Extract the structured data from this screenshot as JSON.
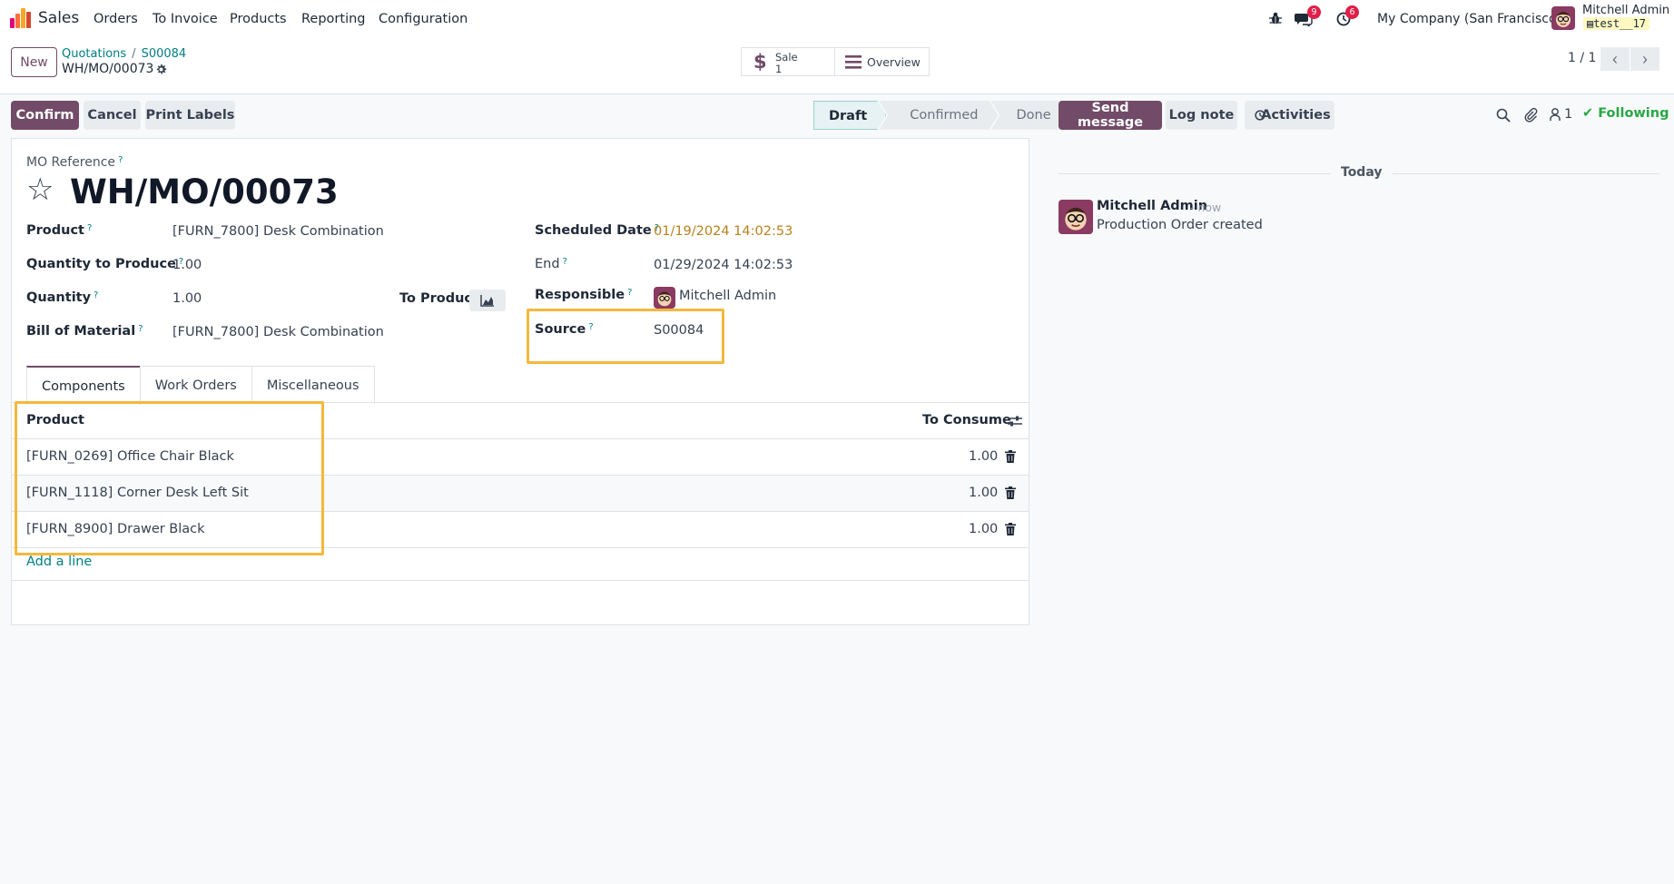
{
  "navbar": {
    "app_name": "Sales",
    "menu": [
      "Orders",
      "To Invoice",
      "Products",
      "Reporting",
      "Configuration"
    ],
    "messages_count": "9",
    "activities_count": "6",
    "company": "My Company (San Francisco)",
    "user_name": "Mitchell Admin",
    "database": "test__17"
  },
  "breadcrumb": {
    "new_label": "New",
    "items": [
      "Quotations",
      "S00084"
    ],
    "current": "WH/MO/00073"
  },
  "smart_buttons": {
    "sale_label": "Sale",
    "sale_count": "1",
    "overview_label": "Overview"
  },
  "pager": {
    "text": "1 / 1"
  },
  "actions": {
    "confirm": "Confirm",
    "cancel": "Cancel",
    "print_labels": "Print Labels"
  },
  "statusbar": {
    "stages": [
      "Draft",
      "Confirmed",
      "Done"
    ],
    "active": "Draft"
  },
  "form": {
    "mo_reference_label": "MO Reference",
    "mo_reference": "WH/MO/00073",
    "product_label": "Product",
    "product": "[FURN_7800] Desk Combination",
    "qty_to_produce_label": "Quantity to Produce",
    "qty_to_produce": "1.00",
    "quantity_label": "Quantity",
    "quantity": "1.00",
    "to_produce_label": "To Produce",
    "bom_label": "Bill of Material",
    "bom": "[FURN_7800] Desk Combination",
    "scheduled_date_label": "Scheduled Date",
    "scheduled_date": "01/19/2024 14:02:53",
    "end_label": "End",
    "end": "01/29/2024 14:02:53",
    "responsible_label": "Responsible",
    "responsible": "Mitchell Admin",
    "source_label": "Source",
    "source": "S00084",
    "help_mark": "?"
  },
  "tabs": [
    "Components",
    "Work Orders",
    "Miscellaneous"
  ],
  "components": {
    "col_product": "Product",
    "col_to_consume": "To Consume",
    "rows": [
      {
        "product": "[FURN_0269] Office Chair Black",
        "qty": "1.00"
      },
      {
        "product": "[FURN_1118] Corner Desk Left Sit",
        "qty": "1.00"
      },
      {
        "product": "[FURN_8900] Drawer Black",
        "qty": "1.00"
      }
    ],
    "add_line": "Add a line"
  },
  "chatter": {
    "send_message": "Send message",
    "log_note": "Log note",
    "activities": "Activities",
    "followers": "1",
    "following": "Following",
    "date_separator": "Today",
    "message": {
      "author": "Mitchell Admin",
      "time": "- now",
      "body": "Production Order created"
    }
  },
  "colors": {
    "brand": "#714b67",
    "link": "#017e84",
    "highlight": "#f5b83d",
    "date_warning": "#b7801b",
    "following": "#28a745"
  },
  "icons": {
    "bug": "bug-icon",
    "messages": "chat-icon",
    "activities": "clock-icon",
    "settings": "gear-icon",
    "favorite": "star-icon",
    "search": "search-icon",
    "attachment": "paperclip-icon",
    "followers": "user-icon",
    "delete": "trash-icon"
  }
}
